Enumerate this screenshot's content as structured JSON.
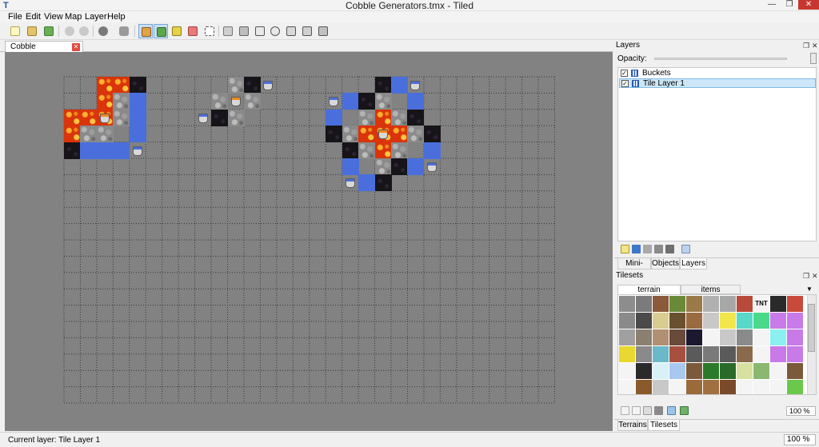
{
  "window": {
    "title": "Cobble Generators.tmx - Tiled",
    "app_icon": "T",
    "minimize": "—",
    "maximize": "❐",
    "close": "✕"
  },
  "menu": [
    "File",
    "Edit",
    "View",
    "Map",
    "Layer",
    "Help"
  ],
  "toolbar": {
    "icons": [
      "new-map-icon",
      "open-icon",
      "save-icon",
      "undo-icon",
      "redo-icon",
      "commands-icon",
      "random-mode-icon",
      "stamp-brush-icon",
      "terrain-brush-icon",
      "bucket-fill-icon",
      "eraser-icon",
      "rectangular-select-icon",
      "magic-wand-icon",
      "select-objects-icon",
      "insert-rectangle-icon",
      "insert-ellipse-icon",
      "insert-polygon-icon",
      "insert-polyline-icon",
      "insert-tile-icon"
    ]
  },
  "document": {
    "tab_label": "Cobble Generators.tmx",
    "close_glyph": "✕"
  },
  "layers_panel": {
    "title": "Layers",
    "opacity_label": "Opacity:",
    "opacity": 1.0,
    "layers": [
      {
        "name": "Buckets",
        "visible_mark": "✓",
        "selected": false
      },
      {
        "name": "Tile Layer 1",
        "visible_mark": "✓",
        "selected": true
      }
    ],
    "tabs": [
      "Mini-map",
      "Objects",
      "Layers"
    ],
    "active_tab": "Layers"
  },
  "tilesets_panel": {
    "title": "Tilesets",
    "tabs": [
      "terrain",
      "items"
    ],
    "active_tab": "terrain",
    "zoom": "100 %",
    "dropdown_glyph": "▼",
    "tnt_label": "TNT",
    "bottom_tabs": [
      "Terrains",
      "Tilesets"
    ],
    "active_bottom_tab": "Tilesets"
  },
  "status": {
    "current_layer": "Current layer: Tile Layer 1",
    "zoom": "100 %"
  },
  "colors": {
    "lava": "#d9340a",
    "water": "#4a6fdc",
    "obsidian": "#161418",
    "cobble": "#8a8a8a",
    "map_bg": "#828282",
    "selection": "#cde6f7"
  }
}
